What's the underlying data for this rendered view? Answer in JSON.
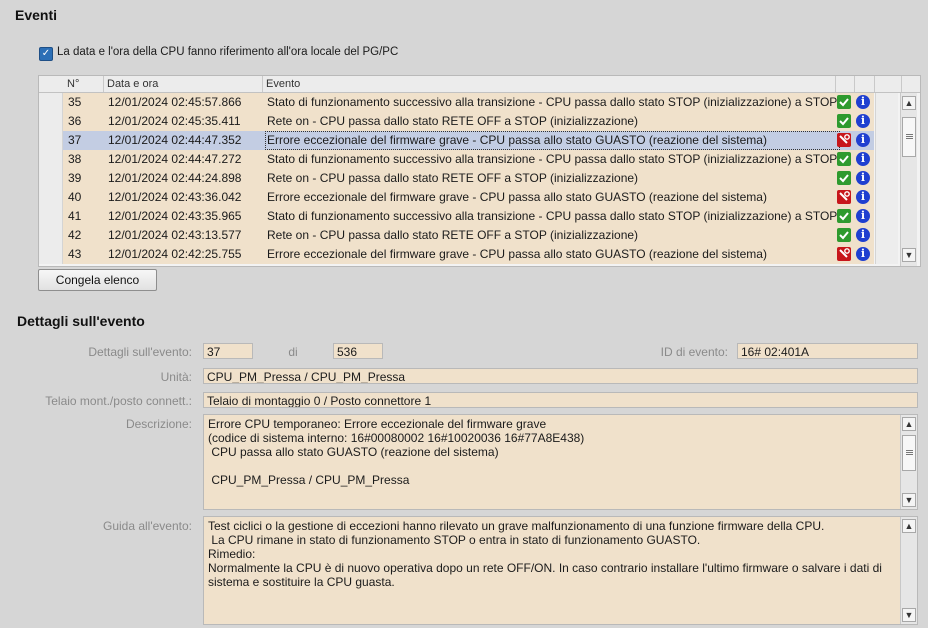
{
  "events_section": {
    "title": "Eventi",
    "local_time_checkbox": {
      "checked": true,
      "label": "La data e l'ora della CPU fanno riferimento all'ora locale del PG/PC"
    },
    "columns": {
      "no": "N°",
      "datetime": "Data e ora",
      "event": "Evento"
    },
    "rows": [
      {
        "no": "35",
        "datetime": "12/01/2024 02:45:57.866",
        "event": "Stato di funzionamento successivo alla transizione  - CPU passa dallo stato STOP (inizializzazione) a STOP",
        "status_icon": "ok-check-icon",
        "selected": false
      },
      {
        "no": "36",
        "datetime": "12/01/2024 02:45:35.411",
        "event": "Rete on  - CPU passa dallo stato RETE OFF a STOP (inizializzazione)",
        "status_icon": "ok-check-icon",
        "selected": false
      },
      {
        "no": "37",
        "datetime": "12/01/2024 02:44:47.352",
        "event": "Errore eccezionale del firmware grave  - CPU passa allo stato GUASTO (reazione del sistema)",
        "status_icon": "error-wrench-icon",
        "selected": true
      },
      {
        "no": "38",
        "datetime": "12/01/2024 02:44:47.272",
        "event": "Stato di funzionamento successivo alla transizione  - CPU passa dallo stato STOP (inizializzazione) a STOP",
        "status_icon": "ok-check-icon",
        "selected": false
      },
      {
        "no": "39",
        "datetime": "12/01/2024 02:44:24.898",
        "event": "Rete on  - CPU passa dallo stato RETE OFF a STOP (inizializzazione)",
        "status_icon": "ok-check-icon",
        "selected": false
      },
      {
        "no": "40",
        "datetime": "12/01/2024 02:43:36.042",
        "event": "Errore eccezionale del firmware grave  - CPU passa allo stato GUASTO (reazione del sistema)",
        "status_icon": "error-wrench-icon",
        "selected": false
      },
      {
        "no": "41",
        "datetime": "12/01/2024 02:43:35.965",
        "event": "Stato di funzionamento successivo alla transizione  - CPU passa dallo stato STOP (inizializzazione) a STOP",
        "status_icon": "ok-check-icon",
        "selected": false
      },
      {
        "no": "42",
        "datetime": "12/01/2024 02:43:13.577",
        "event": "Rete on  - CPU passa dallo stato RETE OFF a STOP (inizializzazione)",
        "status_icon": "ok-check-icon",
        "selected": false
      },
      {
        "no": "43",
        "datetime": "12/01/2024 02:42:25.755",
        "event": "Errore eccezionale del firmware grave  - CPU passa allo stato GUASTO (reazione del sistema)",
        "status_icon": "error-wrench-icon",
        "selected": false
      }
    ],
    "freeze_button": "Congela elenco"
  },
  "details_section": {
    "title": "Dettagli sull'evento",
    "event_details_label": "Dettagli sull'evento:",
    "event_index": "37",
    "of_label": "di",
    "event_total": "536",
    "event_id_label": "ID di evento:",
    "event_id": "16# 02:401A",
    "unit_label": "Unità:",
    "unit": "CPU_PM_Pressa / CPU_PM_Pressa",
    "rack_label": "Telaio mont./posto connett.:",
    "rack": "Telaio di montaggio 0 / Posto connettore 1",
    "description_label": "Descrizione:",
    "description": "Errore CPU temporaneo: Errore eccezionale del firmware grave\n(codice di sistema interno: 16#00080002 16#10020036 16#77A8E438)\n CPU passa allo stato GUASTO (reazione del sistema)\n\n CPU_PM_Pressa / CPU_PM_Pressa",
    "help_label": "Guida all'evento:",
    "help": "Test ciclici o la gestione di eccezioni hanno rilevato un grave malfunzionamento di una funzione firmware della CPU.\n La CPU rimane in stato di funzionamento STOP o entra in stato di funzionamento GUASTO.\nRimedio:\nNormalmente la CPU è di nuovo operativa dopo un rete OFF/ON. In caso contrario installare l'ultimo firmware o salvare i dati di\nsistema e sostituire la CPU guasta."
  },
  "colors": {
    "row_bg": "#f0e1cb",
    "selected_row_bg": "#c3cde3",
    "ok_icon": "#2e9a2e",
    "error_icon": "#c7161b",
    "info_icon": "#1f3fd0"
  }
}
